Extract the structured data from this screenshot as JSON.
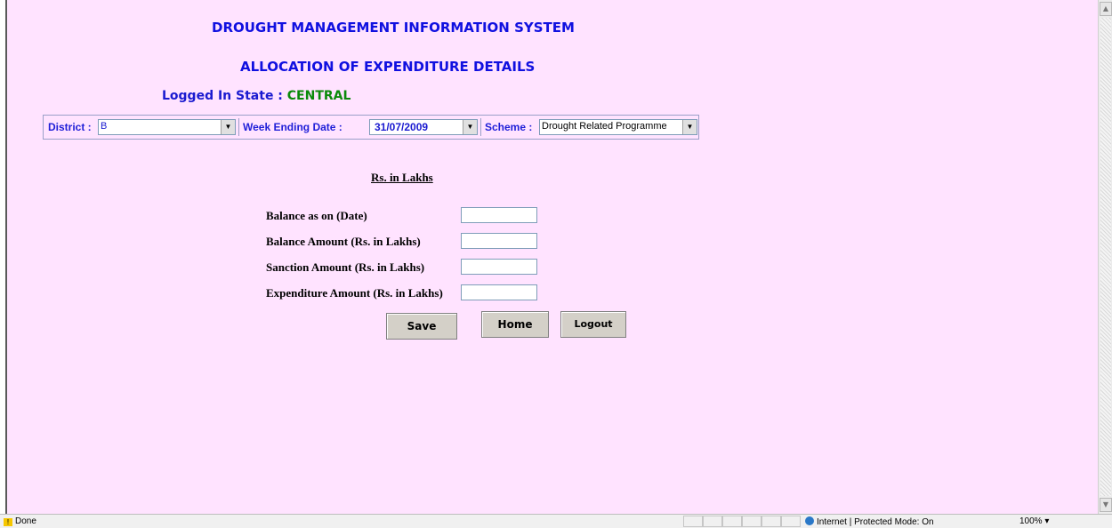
{
  "header": {
    "title": "DROUGHT MANAGEMENT INFORMATION SYSTEM",
    "subtitle": "ALLOCATION OF EXPENDITURE DETAILS",
    "logged_in_label": "Logged In State : ",
    "logged_in_state": "CENTRAL"
  },
  "filters": {
    "district_label": "District :",
    "district_value": "B",
    "week_label": "Week Ending Date :",
    "week_value": "31/07/2009",
    "scheme_label": "Scheme :",
    "scheme_value": "Drought Related Programme"
  },
  "form": {
    "units_label": "Rs. in Lakhs",
    "fields": [
      {
        "label": "Balance as on (Date)",
        "value": ""
      },
      {
        "label": "Balance Amount (Rs. in Lakhs)",
        "value": ""
      },
      {
        "label": "Sanction Amount (Rs. in Lakhs)",
        "value": ""
      },
      {
        "label": "Expenditure Amount (Rs. in Lakhs)",
        "value": ""
      }
    ]
  },
  "buttons": {
    "save": "Save",
    "home": "Home",
    "logout": "Logout"
  },
  "statusbar": {
    "status": "Done",
    "zone": "Internet | Protected Mode: On",
    "zoom": "100%"
  },
  "icons": {
    "scroll_up": "▲",
    "scroll_down": "▼",
    "dropdown": "▼",
    "warning": "!",
    "zoom_dropdown": "▾"
  }
}
